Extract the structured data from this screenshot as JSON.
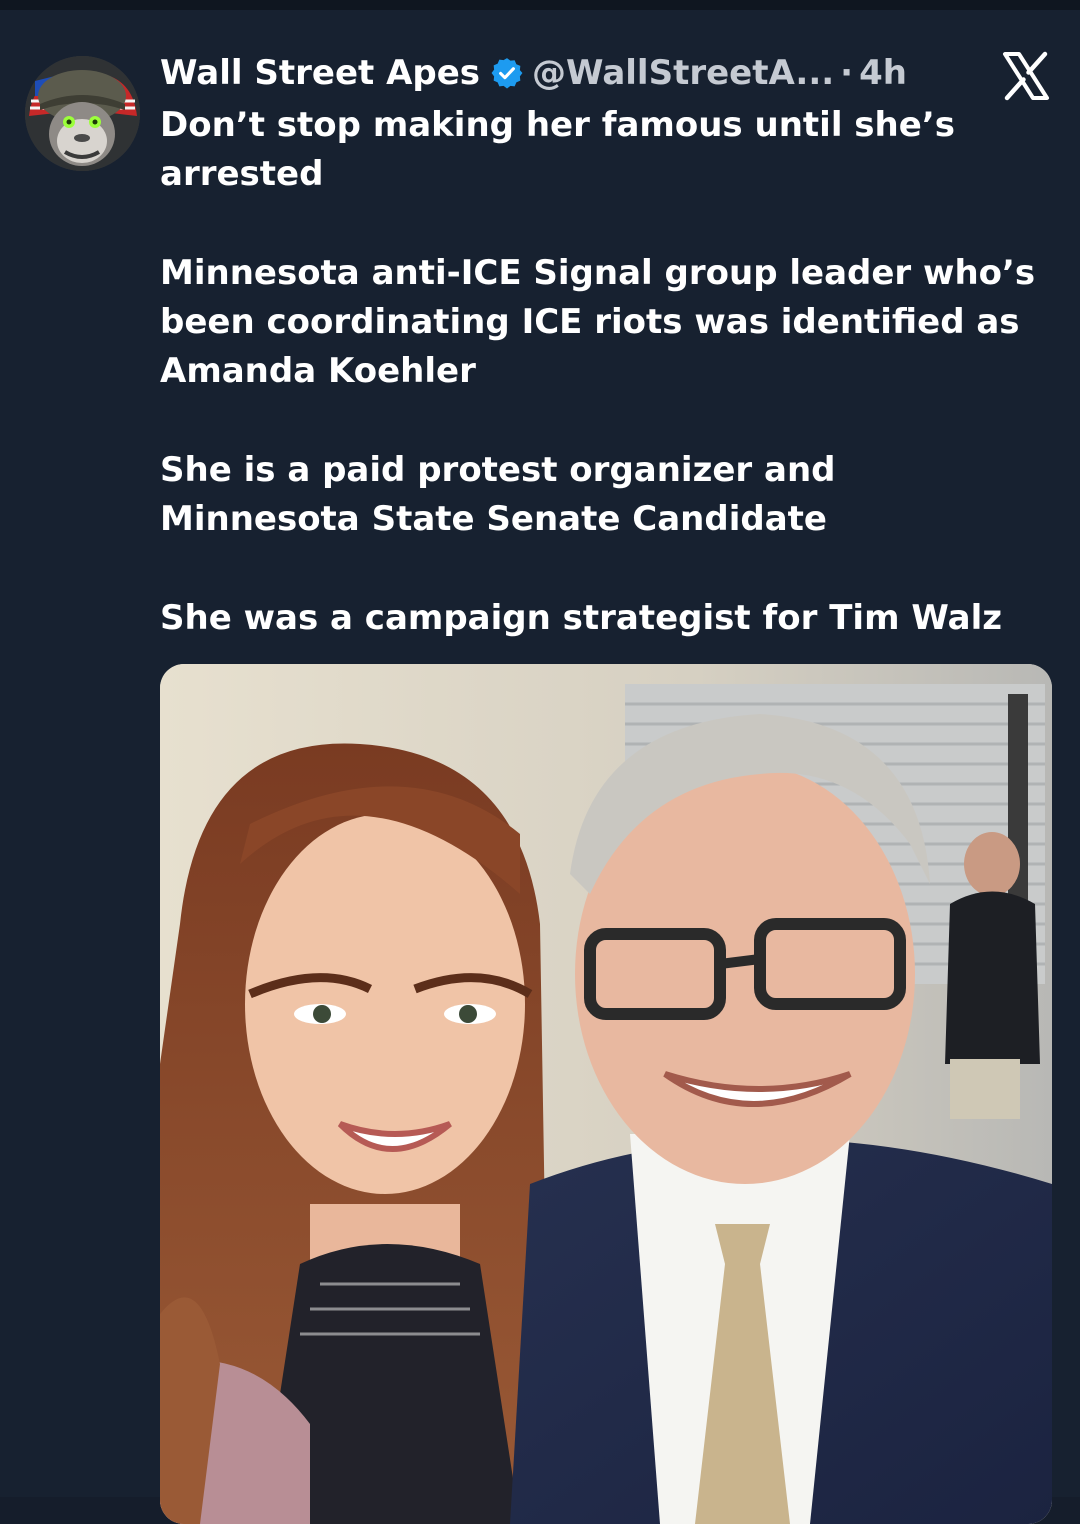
{
  "post": {
    "author_name": "Wall Street Apes",
    "handle": "@WallStreetA...",
    "separator": "·",
    "time": "4h",
    "avatar_icon": "gorilla-soldier-avatar",
    "verified_icon": "verified-badge-icon",
    "verified_color": "#1d9bf0",
    "platform_icon": "x-logo-icon",
    "paragraphs": [
      "Don’t stop making her famous until she’s arrested",
      "Minnesota anti-ICE Signal group leader who’s been coordinating ICE riots was identified as Amanda Koehler",
      "She is a paid protest organizer and Minnesota State Senate Candidate",
      "She was a campaign strategist for Tim Walz"
    ]
  },
  "colors": {
    "background": "#172130",
    "text": "#ffffff",
    "secondary_text": "#c5cad2"
  }
}
